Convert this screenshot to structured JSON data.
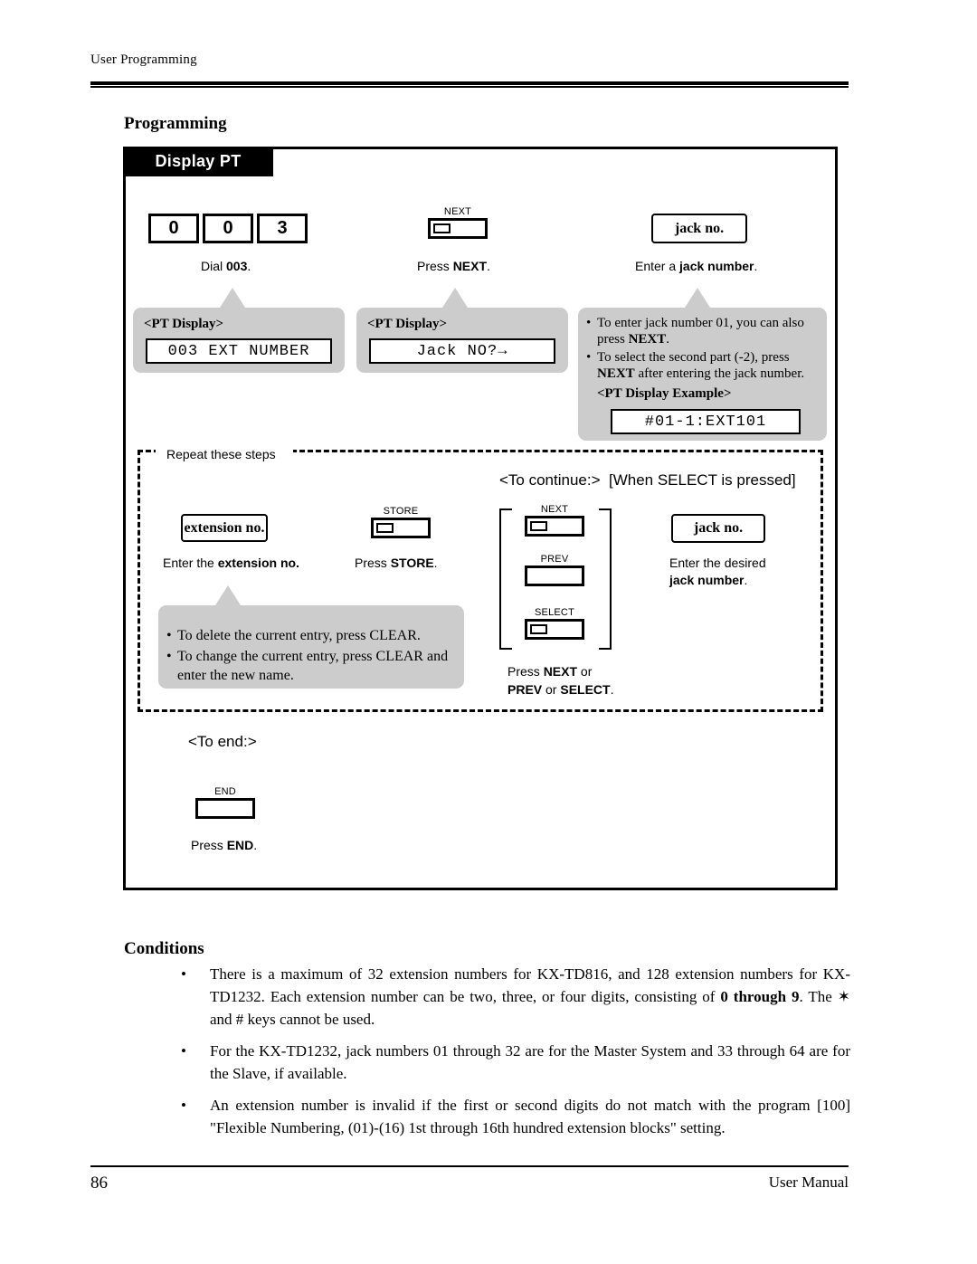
{
  "header": {
    "running_head": "User Programming"
  },
  "sections": {
    "programming_title": "Programming",
    "conditions_title": "Conditions"
  },
  "panel": {
    "tab_label": "Display PT"
  },
  "step_dial": {
    "digits": [
      "0",
      "0",
      "3"
    ],
    "caption_plain": "Dial ",
    "caption_bold": "003",
    "caption_tail": ".",
    "display_title": "<PT Display>",
    "display_text": "003 EXT NUMBER"
  },
  "step_next": {
    "button_cap": "NEXT",
    "caption_plain": "Press ",
    "caption_bold": "NEXT",
    "caption_tail": ".",
    "display_title": "<PT Display>",
    "display_text": "Jack NO?→"
  },
  "step_jack": {
    "box_label": "jack no.",
    "caption_plain": "Enter a ",
    "caption_bold": "jack number",
    "caption_tail": ".",
    "notes": [
      {
        "pre": "To enter jack number 01, you can also press ",
        "bold": "NEXT",
        "post": "."
      },
      {
        "pre": "To select the second part (-2), press ",
        "bold": "NEXT",
        "post": " after entering the jack number."
      }
    ],
    "example_title": "<PT Display Example>",
    "example_text": "#01-1:EXT101"
  },
  "repeat_region": {
    "label": "Repeat these steps"
  },
  "step_extension": {
    "box_label": "extension no.",
    "caption_plain": "Enter the ",
    "caption_bold": "extension no.",
    "caption_tail": "",
    "notes": [
      "To delete the current entry, press CLEAR.",
      "To change the current entry, press CLEAR and enter the new name."
    ]
  },
  "step_store": {
    "button_cap": "STORE",
    "caption_plain": "Press ",
    "caption_bold": "STORE",
    "caption_tail": "."
  },
  "continue_block": {
    "heading_left": "<To continue:>",
    "heading_right": "[When SELECT is pressed]",
    "buttons": [
      {
        "cap": "NEXT",
        "led": true
      },
      {
        "cap": "PREV",
        "led": false
      },
      {
        "cap": "SELECT",
        "led": true
      }
    ],
    "caption_line1_plain": "Press ",
    "caption_line1_bold": "NEXT",
    "caption_line1_tail": " or",
    "caption_line2_bold1": "PREV",
    "caption_line2_mid": " or ",
    "caption_line2_bold2": "SELECT",
    "caption_line2_tail": ".",
    "jack_box_label": "jack no.",
    "jack_caption_line1": "Enter the desired",
    "jack_caption_line2_bold": "jack number",
    "jack_caption_line2_tail": "."
  },
  "end_block": {
    "heading": "<To end:>",
    "button_cap": "END",
    "caption_plain": "Press ",
    "caption_bold": "END",
    "caption_tail": "."
  },
  "conditions": [
    {
      "p1": "There is a maximum of 32 extension numbers for KX-TD816, and 128 extension numbers for KX-TD1232. Each extension number can be two, three, or four digits, consisting of ",
      "b1": "0 through 9",
      "p2": ". The ✶ and # keys cannot be used."
    },
    {
      "p1": "For the KX-TD1232, jack numbers 01 through 32 are for the Master System and 33 through 64 are for the Slave, if available.",
      "b1": "",
      "p2": ""
    },
    {
      "p1": "An extension number is invalid if the first or second digits do not match with the program [100] \"Flexible Numbering, (01)-(16) 1st through 16th hundred extension blocks\" setting.",
      "b1": "",
      "p2": ""
    }
  ],
  "footer": {
    "page_number": "86",
    "manual_name": "User Manual"
  }
}
